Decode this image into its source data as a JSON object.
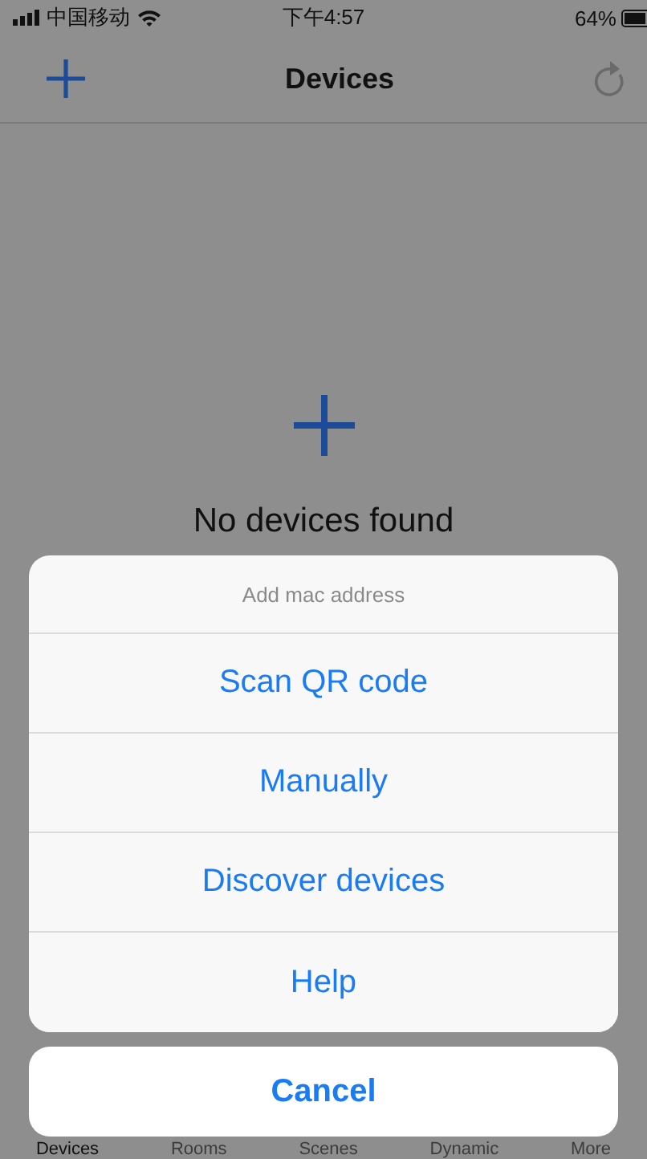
{
  "status_bar": {
    "carrier": "中国移动",
    "time": "下午4:57",
    "battery": "64%"
  },
  "nav_bar": {
    "title": "Devices"
  },
  "empty_state": {
    "message": "No devices found"
  },
  "action_sheet": {
    "title": "Add mac address",
    "options": [
      "Scan QR code",
      "Manually",
      "Discover devices",
      "Help"
    ],
    "cancel": "Cancel"
  },
  "tab_bar": [
    {
      "label": "Devices",
      "selected": true
    },
    {
      "label": "Rooms",
      "selected": false
    },
    {
      "label": "Scenes",
      "selected": false
    },
    {
      "label": "Dynamic",
      "selected": false
    },
    {
      "label": "More",
      "selected": false
    }
  ]
}
